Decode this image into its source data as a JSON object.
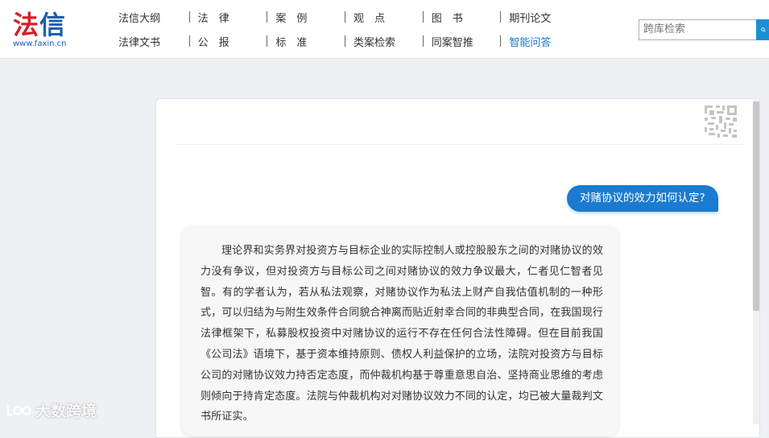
{
  "logo": {
    "text_red": "法",
    "text_blue": "信",
    "url": "www.faxin.cn"
  },
  "nav": {
    "row1": [
      "法信大纲",
      "法　律",
      "案　例",
      "观　点",
      "图　书",
      "期刊论文"
    ],
    "row2": [
      "法律文书",
      "公　报",
      "标　准",
      "类案检索",
      "同案智推",
      "智能问答"
    ],
    "active": "智能问答"
  },
  "search": {
    "placeholder": "跨库检索"
  },
  "chat": {
    "question": "对赌协议的效力如何认定?",
    "answer": "理论界和实务界对投资方与目标企业的实际控制人或控股股东之间的对赌协议的效力没有争议，但对投资方与目标公司之间对赌协议的效力争议最大，仁者见仁智者见智。有的学者认为，若从私法观察，对赌协议作为私法上财产自我估值机制的一种形式，可以归结为与附生效条件合同貌合神离而贴近射幸合同的非典型合同，在我国现行法律框架下，私募股权投资中对赌协议的运行不存在任何合法性障碍。但在目前我国《公司法》语境下，基于资本维持原则、债权人利益保护的立场，法院对投资方与目标公司的对赌协议效力持否定态度，而仲裁机构基于尊重意思自治、坚持商业思维的考虑则倾向于持肯定态度。法院与仲裁机构对对赌协议效力不同的认定，均已被大量裁判文书所证实。"
  },
  "watermark": {
    "text": "大数跨境"
  },
  "colors": {
    "brand_red": "#d6202a",
    "brand_blue": "#1d5fae",
    "accent": "#1a7bd0"
  }
}
